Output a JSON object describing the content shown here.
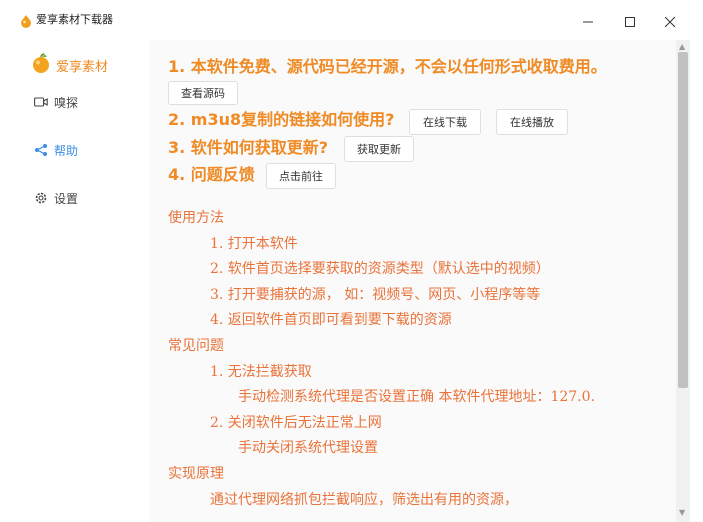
{
  "window": {
    "title": "爱享素材下载器",
    "icons": {
      "app": "orange-drop-icon",
      "minimize": "minimize-icon",
      "maximize": "maximize-icon",
      "close": "close-icon"
    }
  },
  "sidebar": {
    "brand": "爱享素材",
    "items": [
      {
        "label": "嗅探",
        "icon": "video-camera-icon"
      },
      {
        "label": "帮助",
        "icon": "share-icon",
        "active": true
      },
      {
        "label": "设置",
        "icon": "gear-icon"
      }
    ]
  },
  "main": {
    "questions": [
      {
        "text": "1. 本软件免费、源代码已经开源，不会以任何形式收取费用。",
        "buttons": [
          "查看源码"
        ]
      },
      {
        "text": "2. m3u8复制的链接如何使用?",
        "buttons": [
          "在线下载",
          "在线播放"
        ]
      },
      {
        "text": "3. 软件如何获取更新?",
        "buttons": [
          "获取更新"
        ]
      },
      {
        "text": "4. 问题反馈",
        "buttons": [
          "点击前往"
        ]
      }
    ],
    "guide": {
      "usage_title": "使用方法",
      "usage": [
        "1.  打开本软件",
        "2.  软件首页选择要获取的资源类型（默认选中的视频）",
        "3.  打开要捕获的源，  如：视频号、网页、小程序等等",
        "4.  返回软件首页即可看到要下载的资源"
      ],
      "faq_title": "常见问题",
      "faq": [
        {
          "q": "1.  无法拦截获取",
          "a": "手动检测系统代理是否设置正确 本软件代理地址：127.0."
        },
        {
          "q": "2.  关闭软件后无法正常上网",
          "a": "手动关闭系统代理设置"
        }
      ],
      "principle_title": "实现原理",
      "principle": "通过代理网络抓包拦截响应，筛选出有用的资源，"
    }
  },
  "colors": {
    "accent": "#f08a24",
    "guide_text": "#e9733a",
    "active_nav": "#3a8ee6"
  }
}
